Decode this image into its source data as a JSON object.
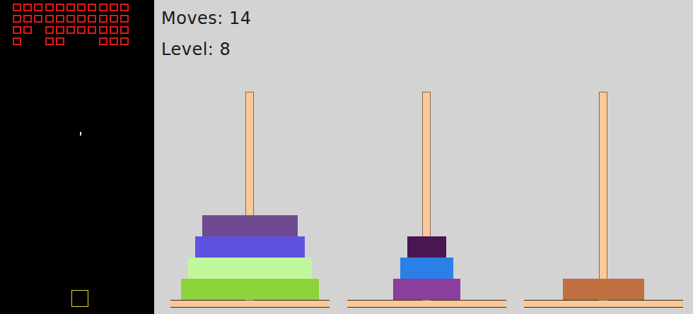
{
  "bricks": [
    [
      true,
      true,
      true,
      true,
      true,
      true,
      true,
      true,
      true,
      true,
      true
    ],
    [
      true,
      true,
      true,
      true,
      true,
      true,
      true,
      true,
      true,
      true,
      true
    ],
    [
      true,
      true,
      false,
      true,
      true,
      true,
      true,
      true,
      true,
      true,
      true
    ],
    [
      true,
      false,
      false,
      true,
      true,
      false,
      false,
      false,
      true,
      true,
      true
    ]
  ],
  "moves": "Moves: 14",
  "level": "Level: 8",
  "towers": [
    {
      "disks": [
        {
          "size": 8,
          "color": "#8bd43b"
        },
        {
          "size": 7,
          "color": "#c0f79a"
        },
        {
          "size": 6,
          "color": "#5f52e0"
        },
        {
          "size": 5,
          "color": "#6e4a90"
        }
      ]
    },
    {
      "disks": [
        {
          "size": 3,
          "color": "#8a3f9e"
        },
        {
          "size": 2,
          "color": "#2b80e8"
        },
        {
          "size": 1,
          "color": "#4a1553"
        }
      ]
    },
    {
      "disks": [
        {
          "size": 4,
          "color": "#c07040"
        }
      ]
    }
  ]
}
